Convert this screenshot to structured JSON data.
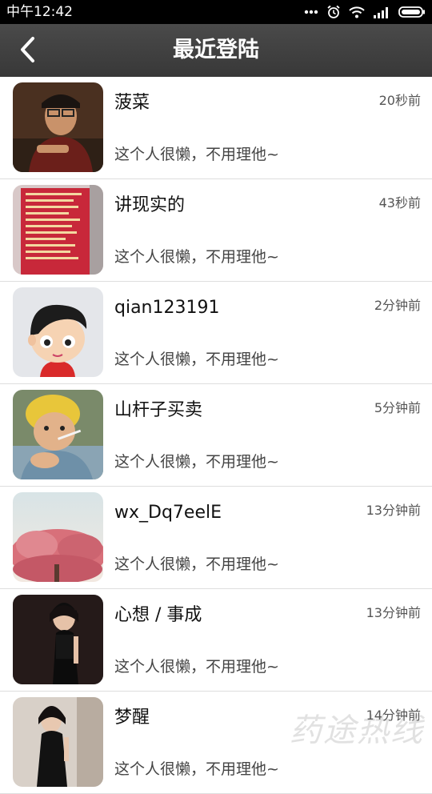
{
  "status_bar": {
    "time": "中午12:42",
    "icons": [
      "more-dots-icon",
      "alarm-icon",
      "wifi-icon",
      "signal-icon",
      "battery-icon"
    ]
  },
  "header": {
    "title": "最近登陆",
    "back_icon": "back-arrow-icon"
  },
  "contacts": [
    {
      "name": "菠菜",
      "time": "20秒前",
      "signature": "这个人很懒，不用理他~"
    },
    {
      "name": "讲现实的",
      "time": "43秒前",
      "signature": "这个人很懒，不用理他~"
    },
    {
      "name": "qian123191",
      "time": "2分钟前",
      "signature": "这个人很懒，不用理他~"
    },
    {
      "name": "山杆子买卖",
      "time": "5分钟前",
      "signature": "这个人很懒，不用理他~"
    },
    {
      "name": "wx_Dq7eelE",
      "time": "13分钟前",
      "signature": "这个人很懒，不用理他~"
    },
    {
      "name": "心想 / 事成",
      "time": "13分钟前",
      "signature": "这个人很懒，不用理他~"
    },
    {
      "name": "梦醒",
      "time": "14分钟前",
      "signature": "这个人很懒，不用理他~"
    }
  ],
  "watermark": "药途热线",
  "colors": {
    "header_bg": "#3f3f3f",
    "status_bg": "#000000",
    "divider": "#dedede"
  }
}
